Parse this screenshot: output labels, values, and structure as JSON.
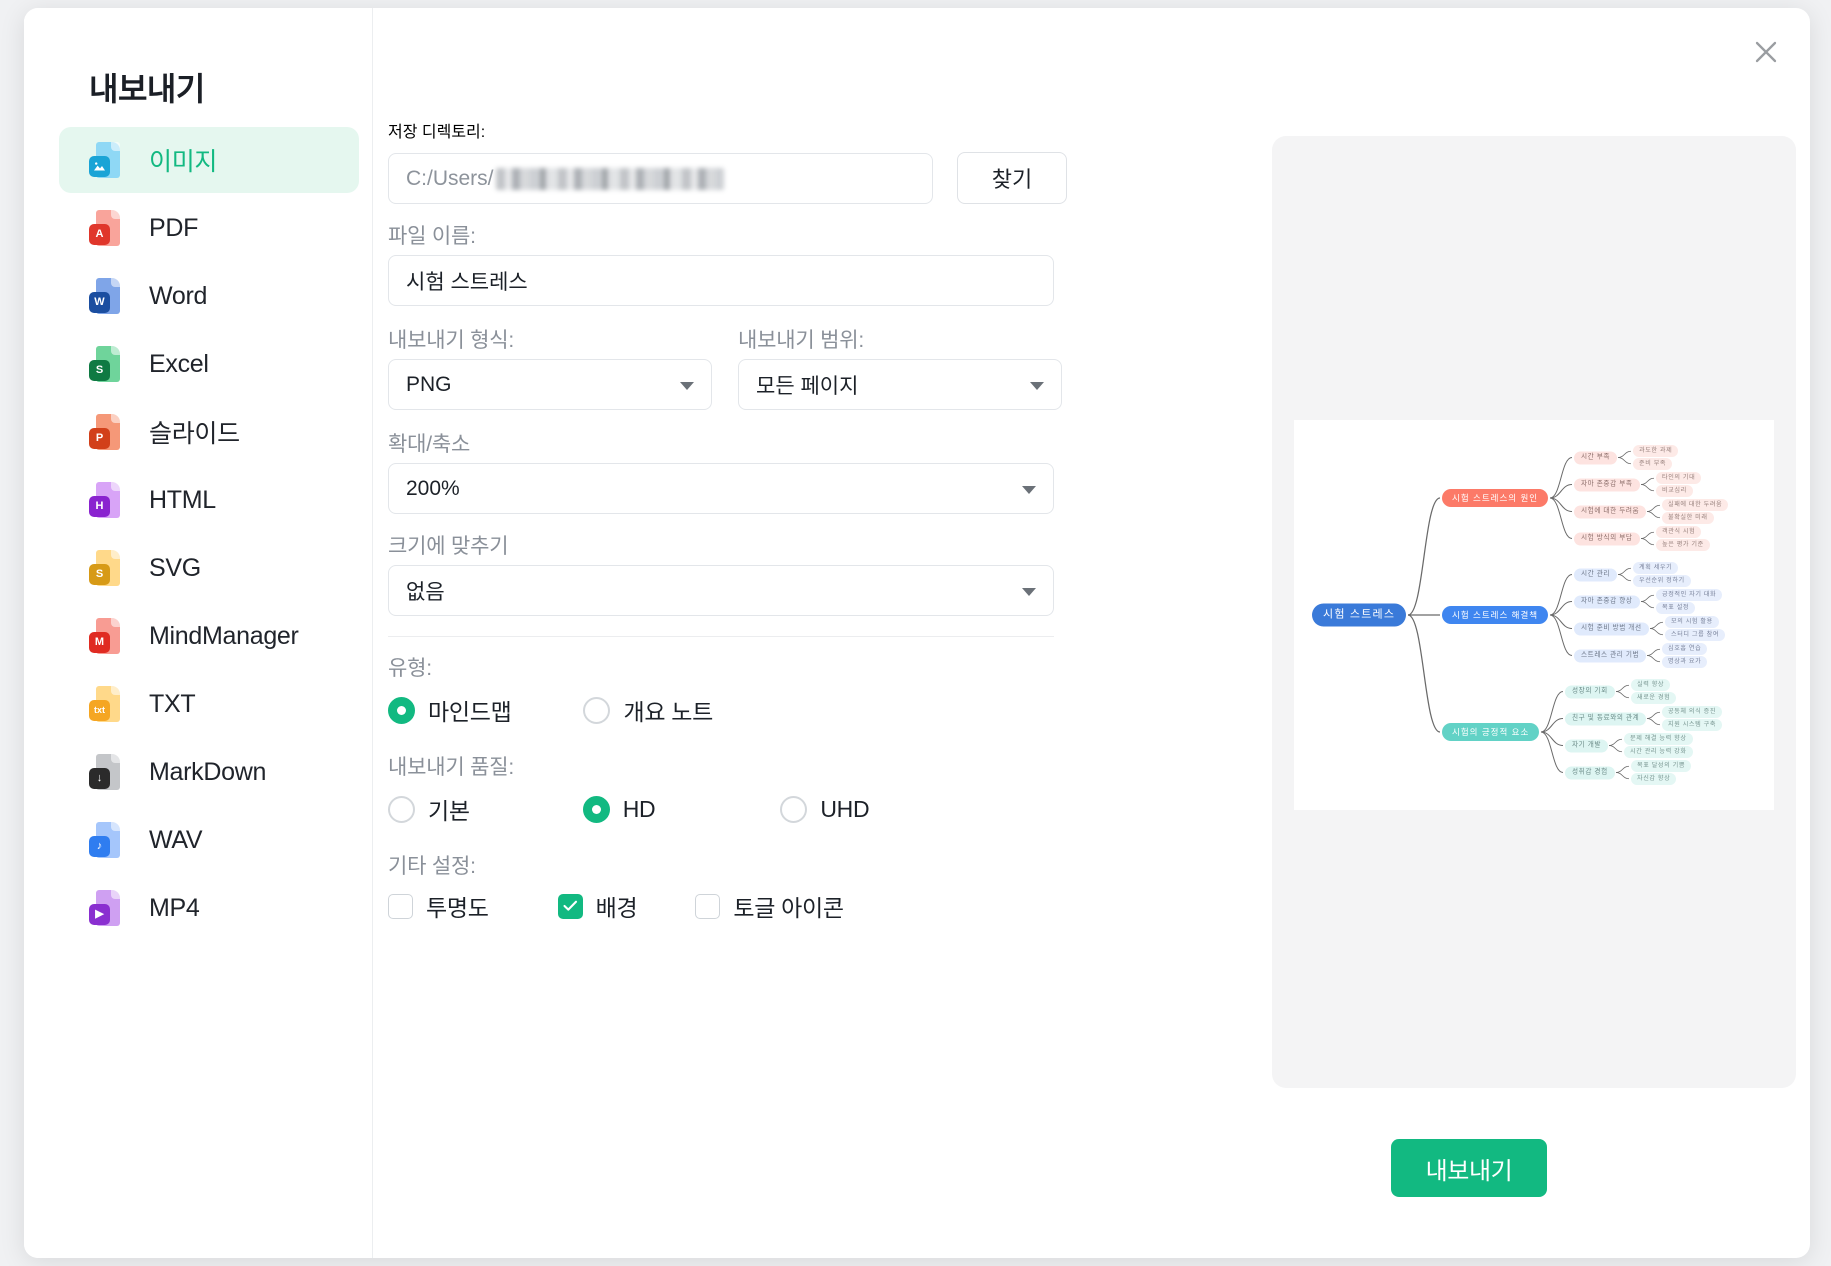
{
  "dialog": {
    "title": "내보내기",
    "close_icon": "close-icon"
  },
  "sidebar": {
    "items": [
      {
        "label": "이미지",
        "icon": "image-file-icon",
        "badge": "",
        "c1": "#8fd8f5",
        "c2": "#1aa4d6",
        "selected": true
      },
      {
        "label": "PDF",
        "icon": "pdf-file-icon",
        "badge": "A",
        "c1": "#f9a49b",
        "c2": "#e0362b",
        "selected": false
      },
      {
        "label": "Word",
        "icon": "word-file-icon",
        "badge": "W",
        "c1": "#7fa5e8",
        "c2": "#1b4ea0",
        "selected": false
      },
      {
        "label": "Excel",
        "icon": "excel-file-icon",
        "badge": "S",
        "c1": "#6fd49b",
        "c2": "#0f7a43",
        "selected": false
      },
      {
        "label": "슬라이드",
        "icon": "slide-file-icon",
        "badge": "P",
        "c1": "#f59878",
        "c2": "#d2401a",
        "selected": false
      },
      {
        "label": "HTML",
        "icon": "html-file-icon",
        "badge": "H",
        "c1": "#d8a4f7",
        "c2": "#8a23cf",
        "selected": false
      },
      {
        "label": "SVG",
        "icon": "svg-file-icon",
        "badge": "S",
        "c1": "#ffd98a",
        "c2": "#d79a16",
        "selected": false
      },
      {
        "label": "MindManager",
        "icon": "mindmanager-file-icon",
        "badge": "M",
        "c1": "#f89c93",
        "c2": "#e02b22",
        "selected": false
      },
      {
        "label": "TXT",
        "icon": "txt-file-icon",
        "badge": "txt",
        "c1": "#ffd98a",
        "c2": "#f5a623",
        "selected": false
      },
      {
        "label": "MarkDown",
        "icon": "markdown-file-icon",
        "badge": "↓",
        "c1": "#c4c6c9",
        "c2": "#2b2b2b",
        "selected": false
      },
      {
        "label": "WAV",
        "icon": "wav-file-icon",
        "badge": "♪",
        "c1": "#a5c6fb",
        "c2": "#2f7df0",
        "selected": false
      },
      {
        "label": "MP4",
        "icon": "mp4-file-icon",
        "badge": "▶",
        "c1": "#cfa0f2",
        "c2": "#8a2fd0",
        "selected": false
      }
    ]
  },
  "form": {
    "save_dir_label": "저장 디렉토리:",
    "save_dir_value": "C:/Users/",
    "browse_label": "찾기",
    "file_name_label": "파일 이름:",
    "file_name_value": "시험 스트레스",
    "format_label": "내보내기 형식:",
    "format_value": "PNG",
    "range_label": "내보내기 범위:",
    "range_value": "모든 페이지",
    "zoom_label": "확대/축소",
    "zoom_value": "200%",
    "fit_label": "크기에 맞추기",
    "fit_value": "없음",
    "type_label": "유형:",
    "type_options": [
      {
        "label": "마인드맵",
        "checked": true
      },
      {
        "label": "개요 노트",
        "checked": false
      }
    ],
    "quality_label": "내보내기 품질:",
    "quality_options": [
      {
        "label": "기본",
        "checked": false
      },
      {
        "label": "HD",
        "checked": true
      },
      {
        "label": "UHD",
        "checked": false
      }
    ],
    "other_label": "기타 설정:",
    "other_options": [
      {
        "label": "투명도",
        "checked": false
      },
      {
        "label": "배경",
        "checked": true
      },
      {
        "label": "토글 아이콘",
        "checked": false
      }
    ]
  },
  "footer": {
    "export_label": "내보내기"
  },
  "colors": {
    "accent": "#12b981",
    "accent_soft": "#e5f7ef",
    "branch_red": "#fc7a68",
    "branch_blue": "#3f86f0",
    "branch_teal": "#62d2c6",
    "root_blue": "#3a7ad9",
    "panel_bg": "#f4f4f5"
  },
  "mindmap": {
    "root": "시험 스트레스",
    "branches": [
      {
        "label": "시험 스트레스의 원인",
        "color": "#fc7a68",
        "children": [
          {
            "label": "시간 부족",
            "leaves": [
              "과도한 과제",
              "준비 부족"
            ]
          },
          {
            "label": "자아 존중감 부족",
            "leaves": [
              "타인의 기대",
              "비교심리"
            ]
          },
          {
            "label": "시험에 대한 두려움",
            "leaves": [
              "실패에 대한 두려움",
              "불확실한 미래"
            ]
          },
          {
            "label": "시험 방식의 부담",
            "leaves": [
              "객관식 시험",
              "높은 평가 기준"
            ]
          }
        ]
      },
      {
        "label": "시험 스트레스 해결책",
        "color": "#3f86f0",
        "children": [
          {
            "label": "시간 관리",
            "leaves": [
              "계획 세우기",
              "우선순위 정하기"
            ]
          },
          {
            "label": "자아 존중감 향상",
            "leaves": [
              "긍정적인 자기 대화",
              "목표 설정"
            ]
          },
          {
            "label": "시험 준비 방법 개선",
            "leaves": [
              "모의 시험 활용",
              "스터디 그룹 참여"
            ]
          },
          {
            "label": "스트레스 관리 기법",
            "leaves": [
              "심호흡 연습",
              "명상과 요가"
            ]
          }
        ]
      },
      {
        "label": "시험의 긍정적 요소",
        "color": "#62d2c6",
        "children": [
          {
            "label": "성장의 기회",
            "leaves": [
              "실력 향상",
              "새로운 경험"
            ]
          },
          {
            "label": "친구 및 동료와의 관계",
            "leaves": [
              "공동체 의식 증진",
              "지원 시스템 구축"
            ]
          },
          {
            "label": "자기 개발",
            "leaves": [
              "문제 해결 능력 향상",
              "시간 관리 능력 강화"
            ]
          },
          {
            "label": "성취감 경험",
            "leaves": [
              "목표 달성의 기쁨",
              "자신감 향상"
            ]
          }
        ]
      }
    ]
  }
}
